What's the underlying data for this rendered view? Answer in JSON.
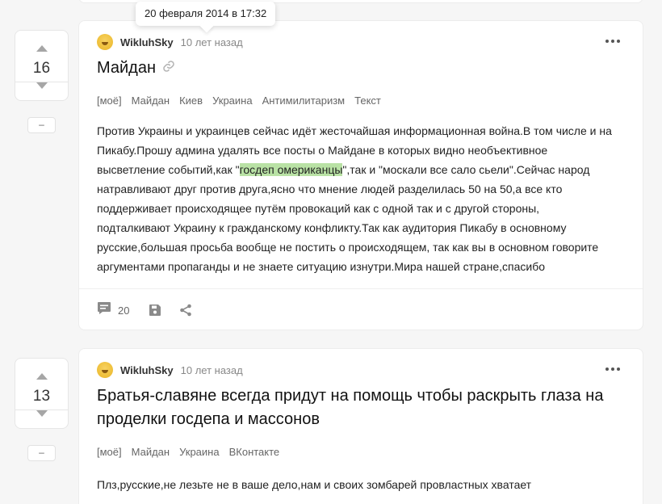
{
  "tooltip": "20 февраля 2014 в 17:32",
  "posts": [
    {
      "rating": "16",
      "minus": "–",
      "author": "WikluhSky",
      "time": "10 лет назад",
      "title": "Майдан",
      "tags": [
        "[моё]",
        "Майдан",
        "Киев",
        "Украина",
        "Антимилитаризм",
        "Текст"
      ],
      "body_lines": [
        "Против Украины и украинцев сейчас идёт жесточайшая информационная война.В том числе и на",
        "Пикабу.Прошу админа удалять все посты о Майдане в которых видно необъективное"
      ],
      "line3_before": "высветление событий,как \"",
      "line3_highlight": "госдеп омериканцы",
      "line3_after": "\",так и \"москали все сало сьели\".Сейчас народ",
      "body_lines_rest": [
        "натравливают друг против друга,ясно что мнение людей разделилась 50 на 50,а все кто",
        "поддерживает происходящее путём провокаций как с одной так и с другой стороны,",
        "подталкивают Украину к гражданскому конфликту.Так как аудитория Пикабу в основному",
        "русские,большая просьба вообще не постить о происходящем, так как вы в основном говорите",
        "аргументами пропаганды и не знаете ситуацию изнутри.Мира нашей стране,спасибо"
      ],
      "comments": "20"
    },
    {
      "rating": "13",
      "minus": "–",
      "author": "WikluhSky",
      "time": "10 лет назад",
      "title_line1": "Братья-славяне всегда придут на помощь чтобы раскрыть глаза на",
      "title_line2": "проделки госдепа и массонов",
      "tags": [
        "[моё]",
        "Майдан",
        "Украина",
        "ВКонтакте"
      ],
      "body": "Плз,русские,не лезьте не в ваше дело,нам и своих зомбарей провластных хватает"
    }
  ],
  "icons": {
    "upvote": "arrow-up-icon",
    "downvote": "arrow-down-icon",
    "link": "link-icon",
    "more": "more-dots-icon",
    "comments": "comment-icon",
    "save": "save-icon",
    "share": "share-icon"
  },
  "colors": {
    "highlight": "#b9e2a5",
    "background": "#f6f6f6"
  }
}
